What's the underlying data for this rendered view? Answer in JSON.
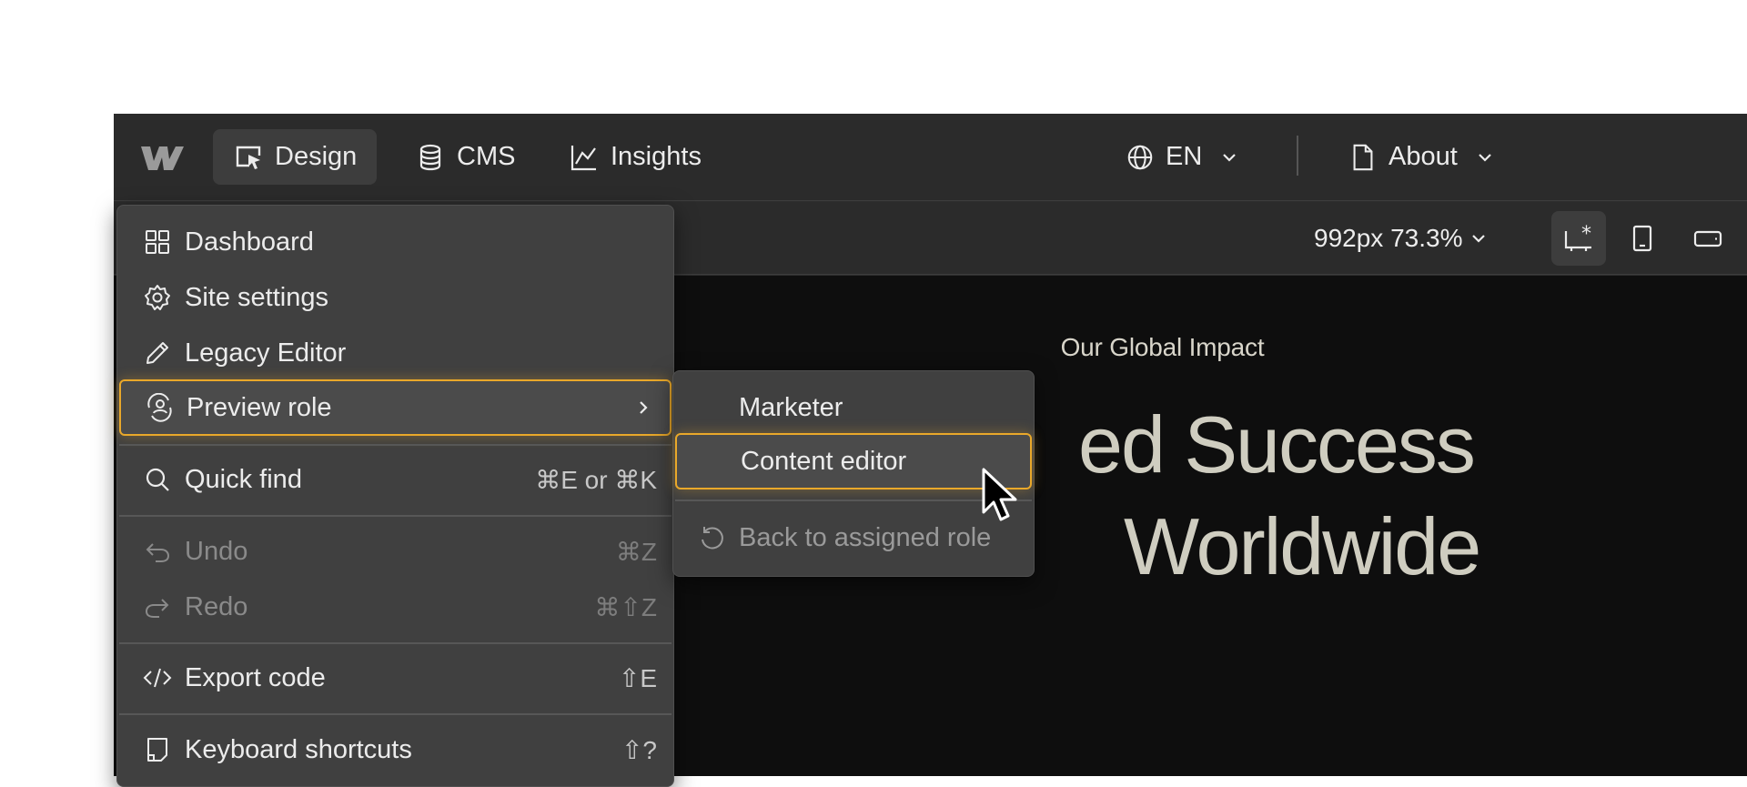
{
  "topbar": {
    "tabs": [
      {
        "label": "Design",
        "icon": "design-cursor-icon"
      },
      {
        "label": "CMS",
        "icon": "database-icon"
      },
      {
        "label": "Insights",
        "icon": "chart-icon"
      }
    ],
    "language": "EN",
    "page": "About"
  },
  "toolbar": {
    "viewport": "992px 73.3%"
  },
  "canvas": {
    "eyebrow": "Our Global Impact",
    "headline_line1": "ed Success",
    "headline_line2": "Worldwide"
  },
  "menu": {
    "items": [
      {
        "label": "Dashboard",
        "icon": "grid-icon"
      },
      {
        "label": "Site settings",
        "icon": "gear-icon"
      },
      {
        "label": "Legacy Editor",
        "icon": "pencil-icon"
      },
      {
        "label": "Preview role",
        "icon": "preview-role-icon"
      },
      {
        "label": "Quick find",
        "shortcut": "⌘E or ⌘K",
        "icon": "search-icon"
      },
      {
        "label": "Undo",
        "shortcut": "⌘Z",
        "icon": "undo-icon"
      },
      {
        "label": "Redo",
        "shortcut": "⌘⇧Z",
        "icon": "redo-icon"
      },
      {
        "label": "Export code",
        "shortcut": "⇧E",
        "icon": "code-icon"
      },
      {
        "label": "Keyboard shortcuts",
        "shortcut": "⇧?",
        "icon": "keyboard-shortcuts-icon"
      }
    ]
  },
  "submenu": {
    "items": [
      {
        "label": "Marketer"
      },
      {
        "label": "Content editor"
      },
      {
        "label": "Back to assigned role",
        "icon": "reset-icon"
      }
    ]
  },
  "colors": {
    "accent": "#e9a82a",
    "menu_bg": "#404040",
    "topbar_bg": "#2b2b2b",
    "canvas_bg": "#0e0e0e"
  }
}
